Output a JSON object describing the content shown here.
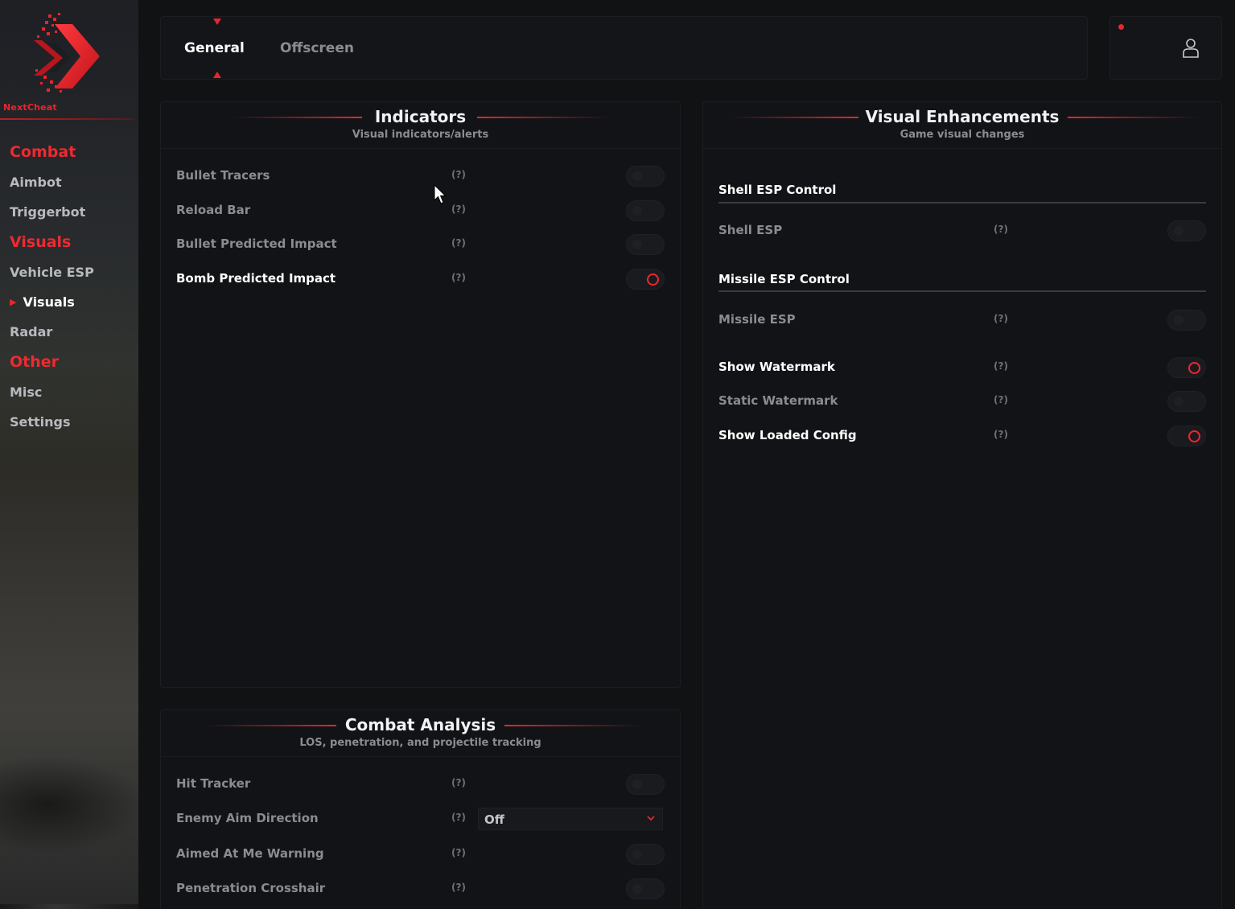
{
  "app": {
    "brand": "NextCheat",
    "accent_color": "#e8262d"
  },
  "sidebar": {
    "groups": [
      {
        "label": "Combat",
        "items": [
          {
            "label": "Aimbot"
          },
          {
            "label": "Triggerbot"
          }
        ]
      },
      {
        "label": "Visuals",
        "items": [
          {
            "label": "Vehicle ESP"
          },
          {
            "label": "Visuals",
            "active": true
          },
          {
            "label": "Radar"
          }
        ]
      },
      {
        "label": "Other",
        "items": [
          {
            "label": "Misc"
          },
          {
            "label": "Settings"
          }
        ]
      }
    ]
  },
  "tabs": [
    {
      "label": "General",
      "active": true
    },
    {
      "label": "Offscreen",
      "active": false
    }
  ],
  "help_glyph": "(?)",
  "indicators": {
    "title": "Indicators",
    "subtitle": "Visual indicators/alerts",
    "rows": [
      {
        "label": "Bullet Tracers",
        "enabled": false
      },
      {
        "label": "Reload Bar",
        "enabled": false
      },
      {
        "label": "Bullet Predicted Impact",
        "enabled": false
      },
      {
        "label": "Bomb Predicted Impact",
        "enabled": true
      }
    ]
  },
  "combat_analysis": {
    "title": "Combat Analysis",
    "subtitle": "LOS, penetration, and projectile tracking",
    "rows": [
      {
        "label": "Hit Tracker",
        "enabled": false
      },
      {
        "label": "Enemy Aim Direction",
        "select_value": "Off"
      },
      {
        "label": "Aimed At Me Warning",
        "enabled": false
      },
      {
        "label": "Penetration Crosshair",
        "enabled": false
      }
    ]
  },
  "visual_enhancements": {
    "title": "Visual Enhancements",
    "subtitle": "Game visual changes",
    "sections": [
      {
        "label": "Shell ESP Control",
        "rows": [
          {
            "label": "Shell ESP",
            "enabled": false
          }
        ]
      },
      {
        "label": "Missile ESP Control",
        "rows": [
          {
            "label": "Missile ESP",
            "enabled": false
          }
        ]
      }
    ],
    "rows": [
      {
        "label": "Show Watermark",
        "enabled": true
      },
      {
        "label": "Static Watermark",
        "enabled": false
      },
      {
        "label": "Show Loaded Config",
        "enabled": true
      }
    ]
  },
  "icons": {
    "logo": "double-chevron-logo",
    "user": "user-icon",
    "status": "status-dot",
    "select": "chevron-down-icon",
    "cursor": "mouse-cursor-icon"
  }
}
